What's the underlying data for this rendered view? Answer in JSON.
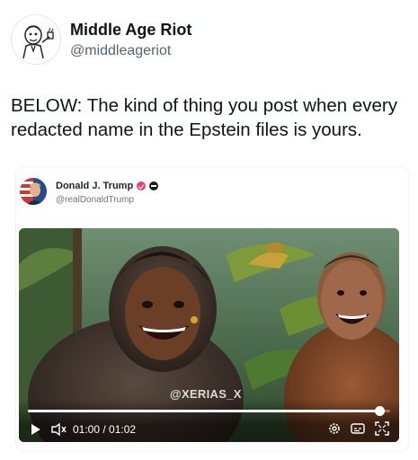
{
  "author": {
    "display_name": "Middle Age Riot",
    "handle": "@middleageriot"
  },
  "tweet": {
    "text": "BELOW: The kind of thing you post when every redacted name in the Epstein files is yours."
  },
  "embedded_post": {
    "display_name": "Donald J. Trump",
    "handle": "@realDonaldTrump",
    "video": {
      "watermark": "@XERIAS_X",
      "time": "01:00 / 01:02",
      "progress": 0.97,
      "icons": [
        "play-icon",
        "volume-icon",
        "settings-icon",
        "captions-icon",
        "fullscreen-icon"
      ]
    }
  },
  "colors": {
    "text": "#0f1419",
    "secondary_text": "#536471",
    "verified_badge": "#e5437a"
  }
}
